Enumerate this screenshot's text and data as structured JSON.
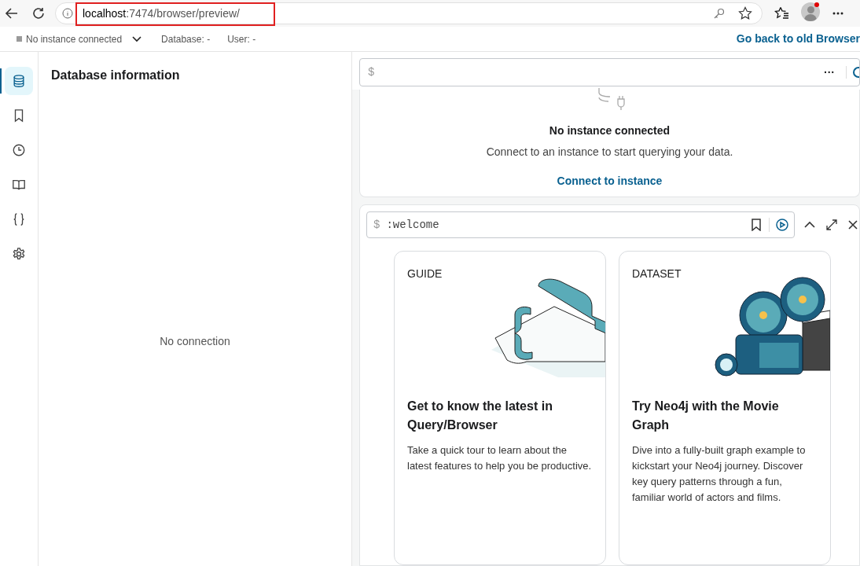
{
  "browser": {
    "url_host": "localhost",
    "url_path": ":7474/browser/preview/"
  },
  "top_bar": {
    "connection": "No instance connected",
    "database_label": "Database:",
    "database_value": "-",
    "user_label": "User:",
    "user_value": "-",
    "back_link": "Go back to old Browser"
  },
  "sidebar": {
    "items": [
      {
        "kind": "database",
        "selected": true
      },
      {
        "kind": "bookmark",
        "selected": false
      },
      {
        "kind": "history",
        "selected": false
      },
      {
        "kind": "book",
        "selected": false
      },
      {
        "kind": "braces",
        "selected": false
      },
      {
        "kind": "settings",
        "selected": false
      }
    ]
  },
  "panel": {
    "title": "Database information",
    "empty_text": "No connection"
  },
  "editor": {
    "prompt": "$",
    "menu": "···"
  },
  "connect_frame": {
    "title": "No instance connected",
    "message": "Connect to an instance to start querying your data.",
    "link": "Connect to instance"
  },
  "welcome_frame": {
    "prompt": "$",
    "command": ":welcome",
    "cards": [
      {
        "kind": "guide",
        "tag": "GUIDE",
        "title": "Get to know the latest in Query/Browser",
        "text": "Take a quick tour to learn about the latest features to help you be productive."
      },
      {
        "kind": "dataset",
        "tag": "DATASET",
        "title": "Try Neo4j with the Movie Graph",
        "text": "Dive into a fully-built graph example to kickstart your Neo4j journey. Discover key query patterns through a fun, familiar world of actors and films."
      }
    ]
  }
}
